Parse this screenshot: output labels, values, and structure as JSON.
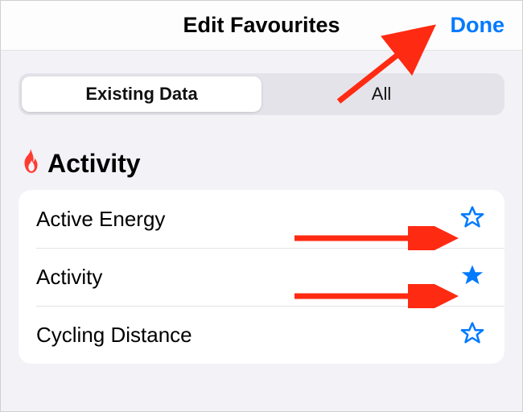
{
  "navbar": {
    "title": "Edit Favourites",
    "done_label": "Done"
  },
  "segmented": {
    "items": [
      {
        "label": "Existing Data",
        "selected": true
      },
      {
        "label": "All",
        "selected": false
      }
    ]
  },
  "section": {
    "icon": "flame-icon",
    "title": "Activity",
    "rows": [
      {
        "label": "Active Energy",
        "favourite": false
      },
      {
        "label": "Activity",
        "favourite": true
      },
      {
        "label": "Cycling Distance",
        "favourite": false
      }
    ]
  },
  "colors": {
    "accent": "#007aff",
    "flame": "#ff3b30",
    "annotation": "#ff2a12"
  }
}
